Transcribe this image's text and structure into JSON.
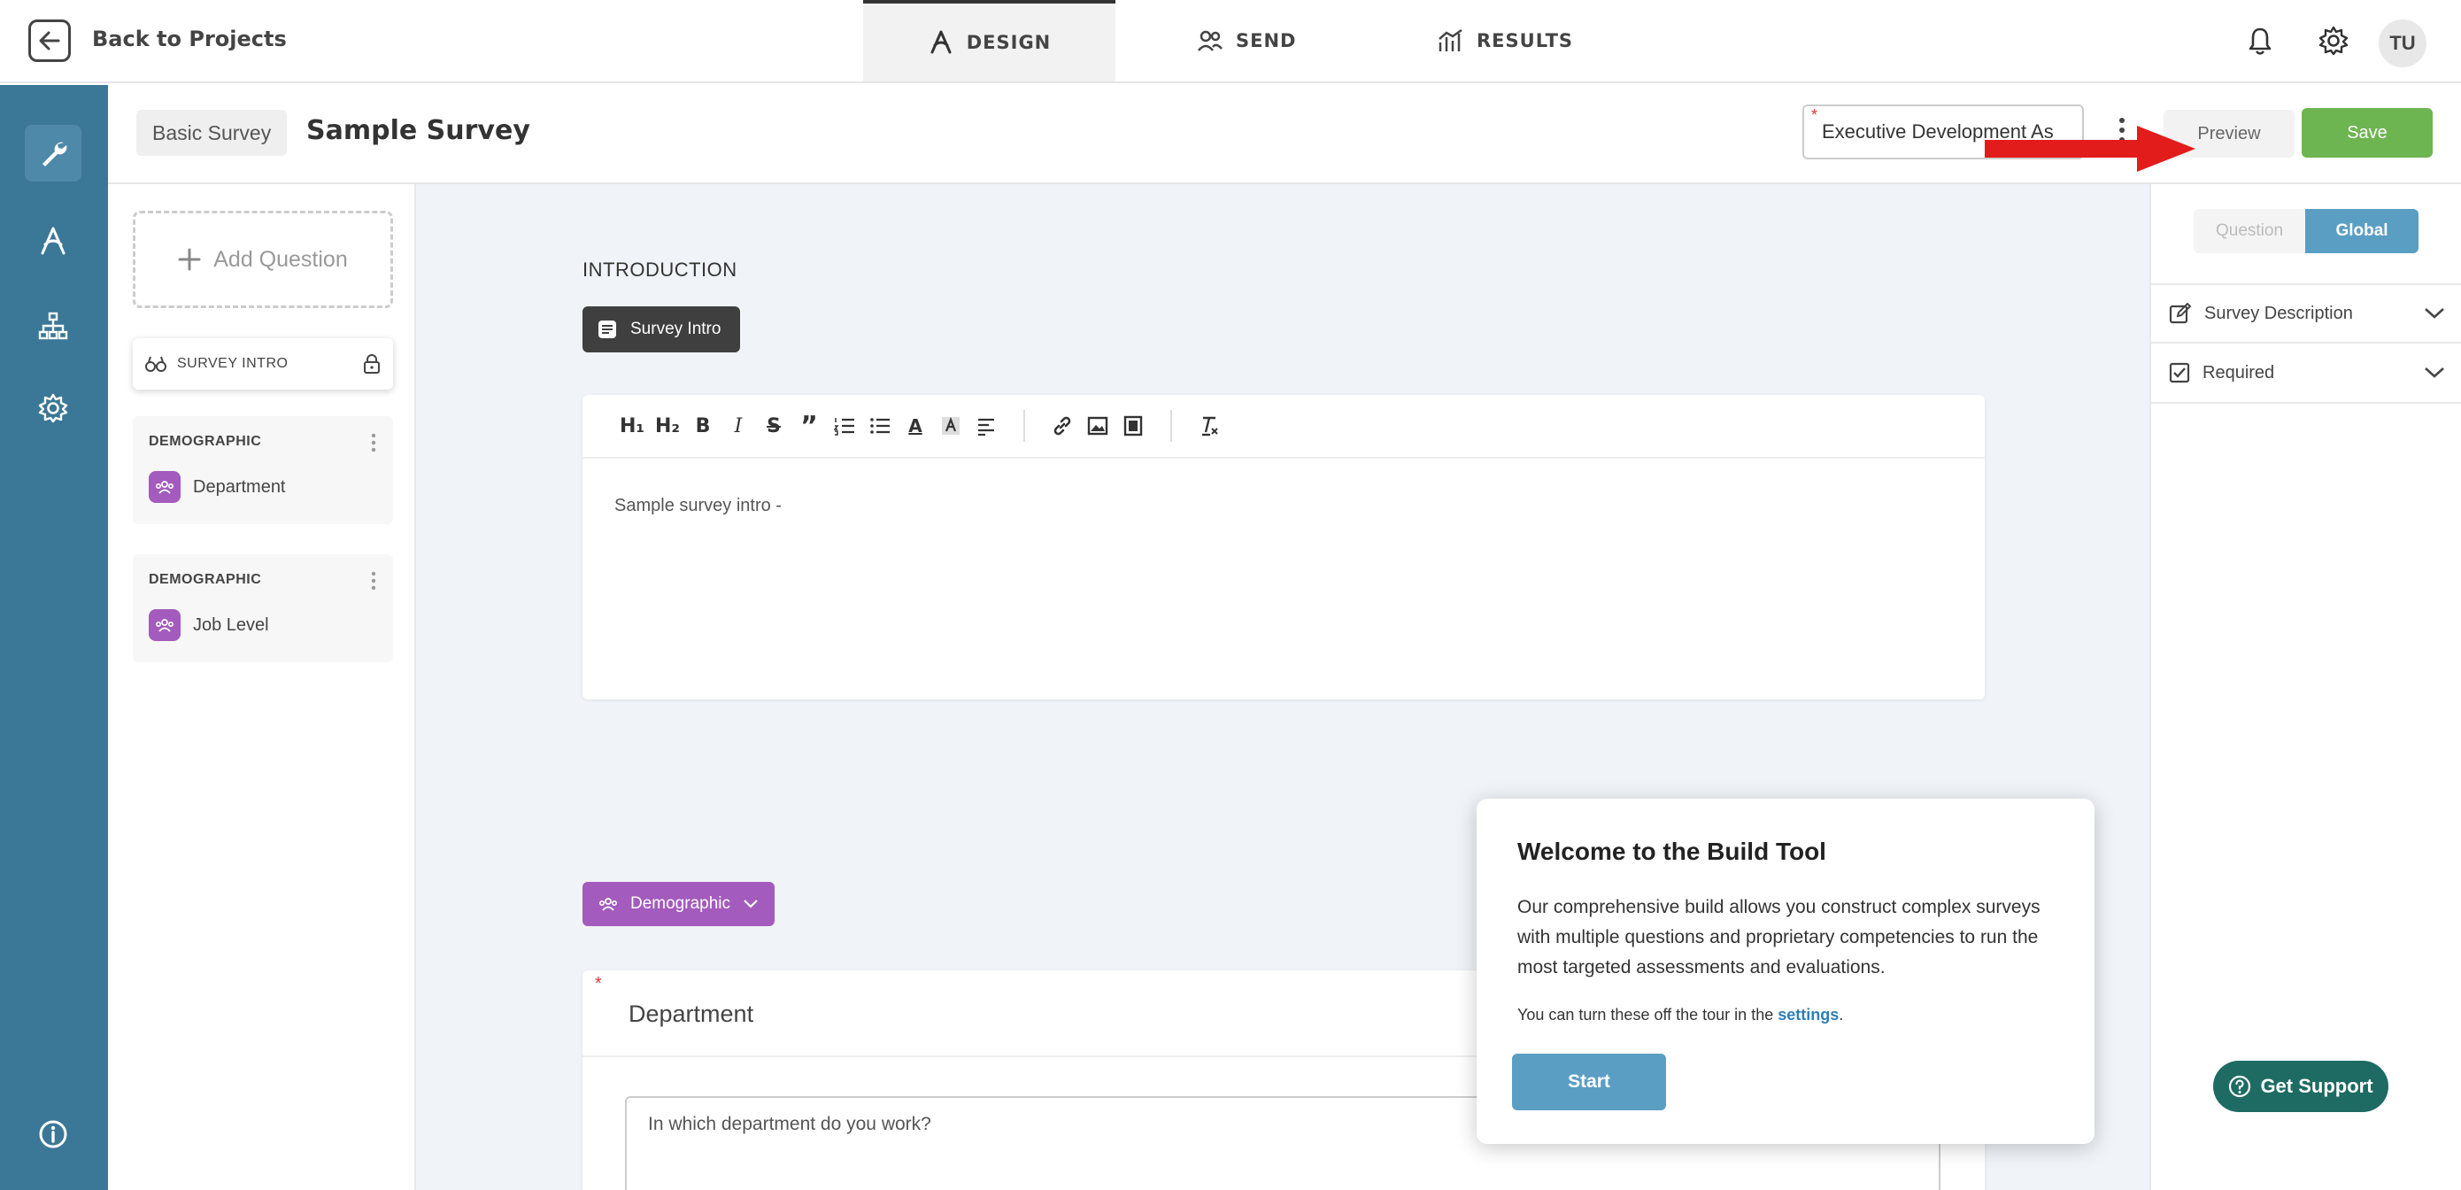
{
  "topbar": {
    "back_label": "Back to Projects",
    "tabs": [
      {
        "label": "DESIGN",
        "icon": "design-compass-icon",
        "active": true
      },
      {
        "label": "SEND",
        "icon": "users-icon",
        "active": false
      },
      {
        "label": "RESULTS",
        "icon": "chart-icon",
        "active": false
      }
    ],
    "avatar_initials": "TU"
  },
  "rail": {
    "icons": [
      "wrench-icon",
      "design-compass-icon",
      "hierarchy-icon",
      "settings-icon",
      "info-icon"
    ],
    "active_color": "#4f89a9",
    "bg_color": "#3b7797"
  },
  "subheader": {
    "survey_type": "Basic Survey",
    "survey_title": "Sample Survey",
    "project_field_value": "Executive Development As",
    "required_mark": "*",
    "preview_label": "Preview",
    "save_label": "Save",
    "save_color": "#6db550"
  },
  "question_list": {
    "add_question_label": "Add Question",
    "intro_label": "SURVEY INTRO",
    "items": [
      {
        "category": "DEMOGRAPHIC",
        "label": "Department"
      },
      {
        "category": "DEMOGRAPHIC",
        "label": "Job Level"
      }
    ]
  },
  "canvas": {
    "intro_heading": "INTRODUCTION",
    "intro_tag": "Survey Intro",
    "editor_text": "Sample survey intro -",
    "toolbar": {
      "h1": "H₁",
      "h2": "H₂",
      "bold": "B",
      "italic": "I",
      "strike": "S",
      "quote": "”",
      "text_color": "A"
    },
    "demographic_tag": "Demographic",
    "department_card": {
      "required_mark": "*",
      "title": "Department",
      "question": "In which department do you work?"
    }
  },
  "right_panel": {
    "seg_question": "Question",
    "seg_global": "Global",
    "accordions": [
      {
        "label": "Survey Description",
        "icon": "edit-icon"
      },
      {
        "label": "Required",
        "icon": "checkbox-icon"
      }
    ]
  },
  "tour": {
    "title": "Welcome to the Build Tool",
    "body": "Our comprehensive build allows you construct complex surveys with multiple questions and proprietary competencies to run the most targeted assessments and evaluations.",
    "note_prefix": "You can turn these off the tour in the ",
    "note_link": "settings",
    "note_suffix": ".",
    "start_label": "Start"
  },
  "support": {
    "label": "Get Support"
  }
}
